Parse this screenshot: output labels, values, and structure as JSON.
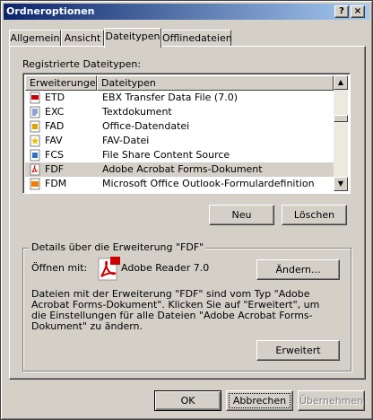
{
  "window": {
    "title": "Ordneroptionen",
    "help_label": "?",
    "close_label": "×"
  },
  "tabs": [
    {
      "label": "Allgemein"
    },
    {
      "label": "Ansicht"
    },
    {
      "label": "Dateitypen",
      "active": true
    },
    {
      "label": "Offlinedateien"
    }
  ],
  "filetypes": {
    "section_label": "Registrierte Dateitypen:",
    "columns": [
      "Erweiterungen",
      "Dateitypen"
    ],
    "rows": [
      {
        "ext": "ETD",
        "type": "EBX Transfer Data File (7.0)",
        "icon": "etd-file-icon"
      },
      {
        "ext": "EXC",
        "type": "Textdokument",
        "icon": "text-file-icon"
      },
      {
        "ext": "FAD",
        "type": "Office-Datendatei",
        "icon": "office-data-icon"
      },
      {
        "ext": "FAV",
        "type": "FAV-Datei",
        "icon": "favorites-file-icon"
      },
      {
        "ext": "FCS",
        "type": "File Share Content Source",
        "icon": "fcs-file-icon"
      },
      {
        "ext": "FDF",
        "type": "Adobe Acrobat Forms-Dokument",
        "icon": "pdf-form-icon",
        "selected": true
      },
      {
        "ext": "FDM",
        "type": "Microsoft Office Outlook-Formulardefinition",
        "icon": "outlook-form-icon"
      }
    ],
    "new_label": "Neu",
    "delete_label": "Löschen"
  },
  "details": {
    "group_label": "Details über die Erweiterung \"FDF\"",
    "open_with_label": "Öffnen mit:",
    "open_with_app": "Adobe Reader 7.0",
    "change_label": "Ändern...",
    "description": "Dateien mit der Erweiterung \"FDF\" sind vom Typ \"Adobe Acrobat Forms-Dokument\". Klicken Sie auf \"Erweitert\", um die Einstellungen für alle Dateien \"Adobe Acrobat Forms-Dokument\" zu ändern.",
    "advanced_label": "Erweitert"
  },
  "footer": {
    "ok_label": "OK",
    "cancel_label": "Abbrechen",
    "apply_label": "Übernehmen"
  },
  "colors": {
    "titlebar_start": "#0a246a",
    "titlebar_end": "#a6caf0",
    "face": "#d4d0c8",
    "acrobat_red": "#cc0000"
  }
}
